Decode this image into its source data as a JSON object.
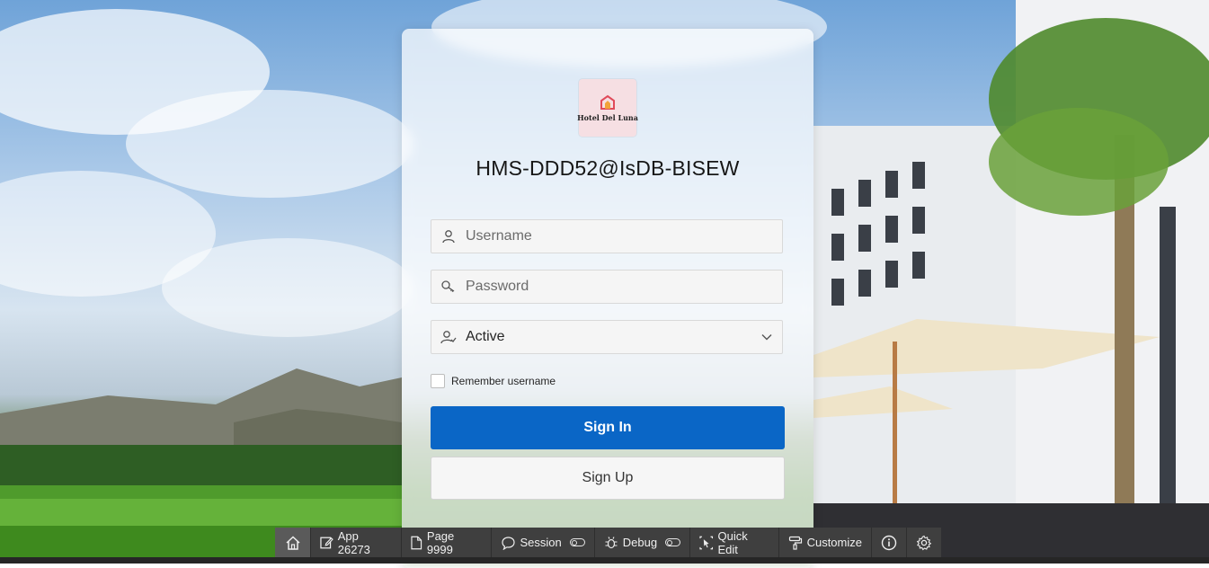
{
  "app": {
    "title": "HMS-DDD52@IsDB-BISEW",
    "logo_text": "Hotel Del Luna"
  },
  "form": {
    "username_placeholder": "Username",
    "password_placeholder": "Password",
    "status_value": "Active",
    "remember_label": "Remember username",
    "sign_in_label": "Sign In",
    "sign_up_label": "Sign Up"
  },
  "devbar": {
    "app_label": "App 26273",
    "page_label": "Page 9999",
    "session_label": "Session",
    "debug_label": "Debug",
    "quick_edit_label": "Quick Edit",
    "customize_label": "Customize"
  },
  "colors": {
    "primary": "#0a66c6",
    "devbar": "#3f3f3f"
  },
  "icons": [
    "home-icon",
    "edit-icon",
    "page-icon",
    "session-icon",
    "debug-icon",
    "quick-edit-icon",
    "customize-icon",
    "info-icon",
    "gear-icon",
    "user-icon",
    "key-icon",
    "user-status-icon",
    "chevron-down-icon"
  ]
}
